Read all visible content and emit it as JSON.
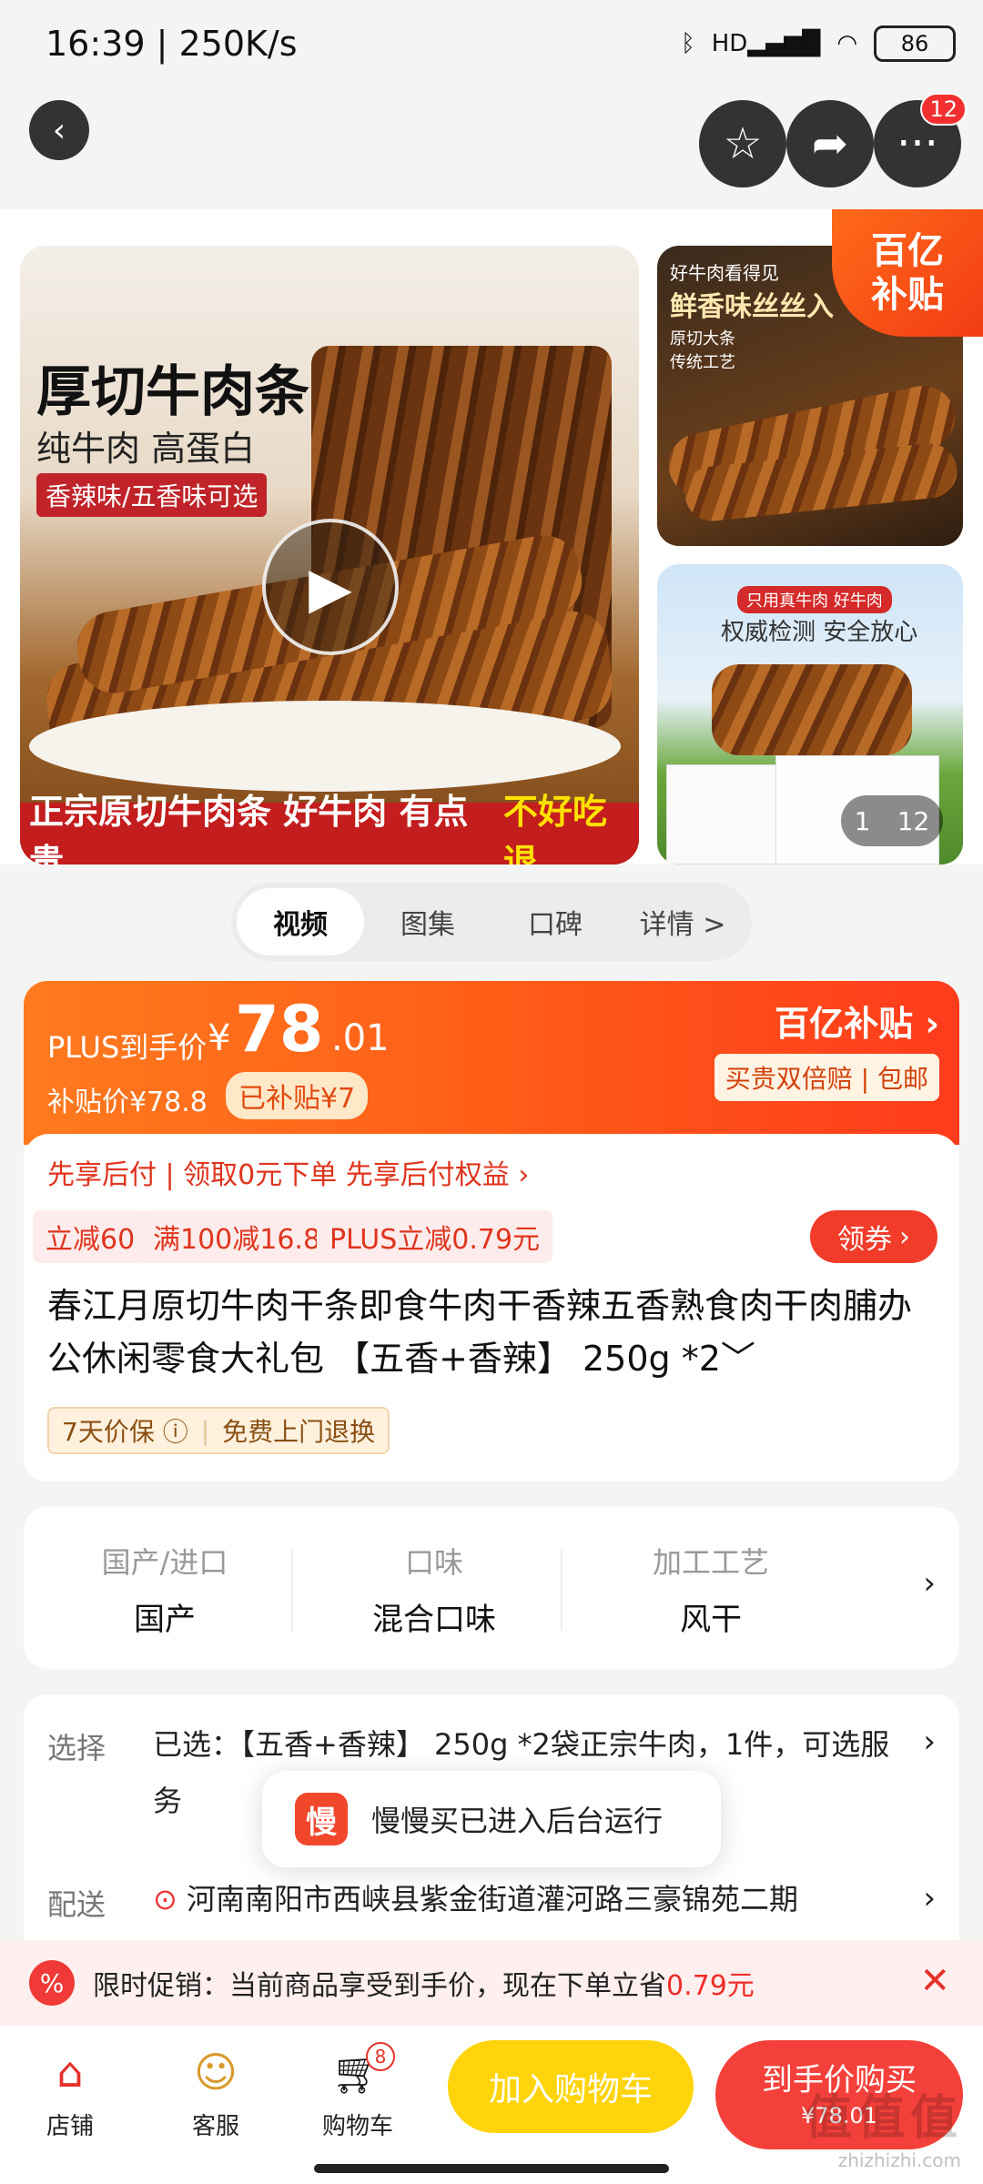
{
  "status_bar": {
    "time": "16:39 | 250K/s",
    "battery": "86",
    "signal": "HD",
    "icons": [
      "mute-icon",
      "alarm-icon",
      "bluetooth-icon",
      "wifi-icon"
    ]
  },
  "nav": {
    "more_badge": "12"
  },
  "gallery": {
    "main_title": "厚切牛肉条",
    "main_sub": "纯牛肉 高蛋白",
    "main_tag": "香辣味/五香味可选",
    "main_banner": "正宗原切牛肉条 好牛肉 有点贵",
    "main_banner_highlight": "不好吃退",
    "side1_small": "好牛肉看得见",
    "side1_title": "鲜香味丝丝入",
    "side1_b1": "原切大条",
    "side1_b2": "传统工艺",
    "side2_tag": "只用真牛肉 好牛肉",
    "side2_title": "权威检测 安全放心",
    "corner_line1": "百亿",
    "corner_line2": "补贴",
    "counter_current": "1",
    "counter_total": "12"
  },
  "tabs": [
    {
      "label": "视频"
    },
    {
      "label": "图集"
    },
    {
      "label": "口碑"
    },
    {
      "label": "详情 >"
    }
  ],
  "price": {
    "plus_label": "PLUS到手价",
    "yen": "¥",
    "integer": "78",
    "decimal": ".01",
    "subsidy_price": "补贴价¥78.8",
    "subsidized": "已补贴¥7",
    "brand": "百亿补贴 ›",
    "brand_tags": "买贵双倍赔 | 包邮"
  },
  "benefits": {
    "pay_later": "先享后付 | 领取0元下单 先享后付权益 ›",
    "coupons": [
      "立减60",
      "满100减16.8",
      "PLUS立减0.79元"
    ],
    "get_coupon": "领券"
  },
  "product": {
    "title": "春江月原切牛肉干条即食牛肉干香辣五香熟食肉干肉脯办公休闲零食大礼包 【五香+香辣】 250g *2﹀",
    "guarantee1": "7天价保 ⓘ",
    "guarantee2": "免费上门退换"
  },
  "attributes": [
    {
      "key": "国产/进口",
      "value": "国产"
    },
    {
      "key": "口味",
      "value": "混合口味"
    },
    {
      "key": "加工工艺",
      "value": "风干"
    }
  ],
  "selection": {
    "select_key": "选择",
    "select_value": "已选：【五香+香辣】 250g *2袋正宗牛肉，1件，可选服务",
    "ship_key": "配送",
    "ship_value": "河南南阳市西峡县紫金街道灌河路三豪锦苑二期"
  },
  "toast": {
    "icon_text": "慢",
    "message": "慢慢买已进入后台运行"
  },
  "promo": {
    "icon": "%",
    "text": "限时促销：当前商品享受到手价，现在下单立省",
    "amount": "0.79元"
  },
  "bottom": {
    "shop": "店铺",
    "service": "客服",
    "cart": "购物车",
    "cart_badge": "8",
    "add_to_cart": "加入购物车",
    "buy": "到手价购买",
    "buy_price": "¥78.01"
  },
  "watermark": {
    "text": "值值值",
    "url": "zhizhizhi.com"
  }
}
